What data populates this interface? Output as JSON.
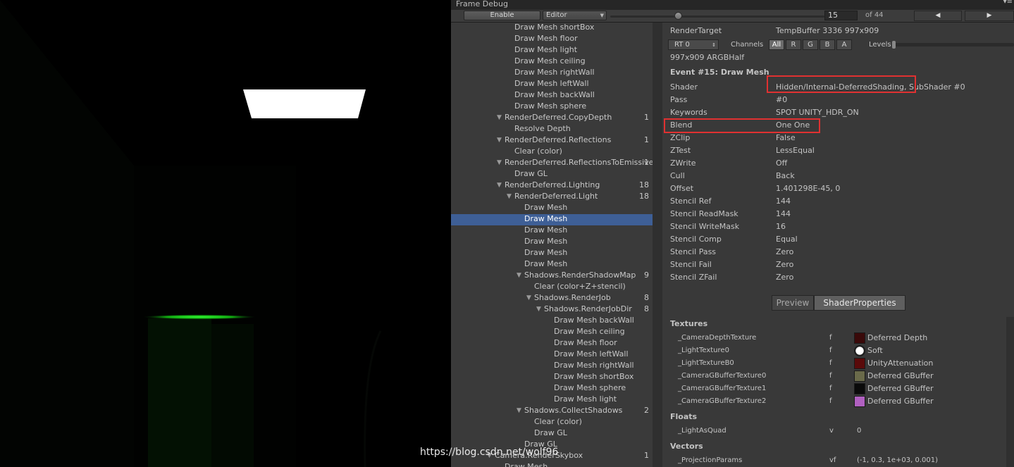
{
  "window": {
    "title": "Frame Debug",
    "menu_icon": "menu-icon"
  },
  "toolbar": {
    "enable_label": "Enable",
    "target_dropdown": "Editor",
    "event_index": "15",
    "event_of": "of 44",
    "prev_icon": "◀",
    "next_icon": "▶"
  },
  "tree": [
    {
      "label": "Draw Mesh shortBox",
      "indent": 5,
      "caret": false,
      "count": ""
    },
    {
      "label": "Draw Mesh floor",
      "indent": 5,
      "caret": false,
      "count": ""
    },
    {
      "label": "Draw Mesh light",
      "indent": 5,
      "caret": false,
      "count": ""
    },
    {
      "label": "Draw Mesh ceiling",
      "indent": 5,
      "caret": false,
      "count": ""
    },
    {
      "label": "Draw Mesh rightWall",
      "indent": 5,
      "caret": false,
      "count": ""
    },
    {
      "label": "Draw Mesh leftWall",
      "indent": 5,
      "caret": false,
      "count": ""
    },
    {
      "label": "Draw Mesh backWall",
      "indent": 5,
      "caret": false,
      "count": ""
    },
    {
      "label": "Draw Mesh sphere",
      "indent": 5,
      "caret": false,
      "count": ""
    },
    {
      "label": "RenderDeferred.CopyDepth",
      "indent": 4,
      "caret": true,
      "count": "1"
    },
    {
      "label": "Resolve Depth",
      "indent": 5,
      "caret": false,
      "count": ""
    },
    {
      "label": "RenderDeferred.Reflections",
      "indent": 4,
      "caret": true,
      "count": "1"
    },
    {
      "label": "Clear (color)",
      "indent": 5,
      "caret": false,
      "count": ""
    },
    {
      "label": "RenderDeferred.ReflectionsToEmissive",
      "indent": 4,
      "caret": true,
      "count": "1"
    },
    {
      "label": "Draw GL",
      "indent": 5,
      "caret": false,
      "count": ""
    },
    {
      "label": "RenderDeferred.Lighting",
      "indent": 4,
      "caret": true,
      "count": "18"
    },
    {
      "label": "RenderDeferred.Light",
      "indent": 5,
      "caret": true,
      "count": "18"
    },
    {
      "label": "Draw Mesh",
      "indent": 6,
      "caret": false,
      "count": ""
    },
    {
      "label": "Draw Mesh",
      "indent": 6,
      "caret": false,
      "count": "",
      "selected": true
    },
    {
      "label": "Draw Mesh",
      "indent": 6,
      "caret": false,
      "count": ""
    },
    {
      "label": "Draw Mesh",
      "indent": 6,
      "caret": false,
      "count": ""
    },
    {
      "label": "Draw Mesh",
      "indent": 6,
      "caret": false,
      "count": ""
    },
    {
      "label": "Draw Mesh",
      "indent": 6,
      "caret": false,
      "count": ""
    },
    {
      "label": "Shadows.RenderShadowMap",
      "indent": 6,
      "caret": true,
      "count": "9"
    },
    {
      "label": "Clear (color+Z+stencil)",
      "indent": 7,
      "caret": false,
      "count": ""
    },
    {
      "label": "Shadows.RenderJob",
      "indent": 7,
      "caret": true,
      "count": "8"
    },
    {
      "label": "Shadows.RenderJobDir",
      "indent": 8,
      "caret": true,
      "count": "8"
    },
    {
      "label": "Draw Mesh backWall",
      "indent": 9,
      "caret": false,
      "count": ""
    },
    {
      "label": "Draw Mesh ceiling",
      "indent": 9,
      "caret": false,
      "count": ""
    },
    {
      "label": "Draw Mesh floor",
      "indent": 9,
      "caret": false,
      "count": ""
    },
    {
      "label": "Draw Mesh leftWall",
      "indent": 9,
      "caret": false,
      "count": ""
    },
    {
      "label": "Draw Mesh rightWall",
      "indent": 9,
      "caret": false,
      "count": ""
    },
    {
      "label": "Draw Mesh shortBox",
      "indent": 9,
      "caret": false,
      "count": ""
    },
    {
      "label": "Draw Mesh sphere",
      "indent": 9,
      "caret": false,
      "count": ""
    },
    {
      "label": "Draw Mesh light",
      "indent": 9,
      "caret": false,
      "count": ""
    },
    {
      "label": "Shadows.CollectShadows",
      "indent": 6,
      "caret": true,
      "count": "2"
    },
    {
      "label": "Clear (color)",
      "indent": 7,
      "caret": false,
      "count": ""
    },
    {
      "label": "Draw GL",
      "indent": 7,
      "caret": false,
      "count": ""
    },
    {
      "label": "Draw GL",
      "indent": 6,
      "caret": false,
      "count": ""
    },
    {
      "label": "Camera.RenderSkybox",
      "indent": 3,
      "caret": true,
      "count": "1"
    },
    {
      "label": "Draw Mesh",
      "indent": 4,
      "caret": false,
      "count": ""
    }
  ],
  "detail": {
    "render_target_label": "RenderTarget",
    "render_target_value": "TempBuffer 3336 997x909",
    "rt_dropdown": "RT 0",
    "channels_label": "Channels",
    "channels": [
      "All",
      "R",
      "G",
      "B",
      "A"
    ],
    "levels_label": "Levels",
    "format": "997x909 ARGBHalf",
    "event_header": "Event #15: Draw Mesh",
    "state": [
      {
        "key": "Shader",
        "value": "Hidden/Internal-DeferredShading, SubShader #0"
      },
      {
        "key": "Pass",
        "value": "#0"
      },
      {
        "key": "Keywords",
        "value": "SPOT UNITY_HDR_ON"
      },
      {
        "key": "Blend",
        "value": "One One"
      },
      {
        "key": "ZClip",
        "value": "False"
      },
      {
        "key": "ZTest",
        "value": "LessEqual"
      },
      {
        "key": "ZWrite",
        "value": "Off"
      },
      {
        "key": "Cull",
        "value": "Back"
      },
      {
        "key": "Offset",
        "value": "1.401298E-45, 0"
      },
      {
        "key": "Stencil Ref",
        "value": "144"
      },
      {
        "key": "Stencil ReadMask",
        "value": "144"
      },
      {
        "key": "Stencil WriteMask",
        "value": "16"
      },
      {
        "key": "Stencil Comp",
        "value": "Equal"
      },
      {
        "key": "Stencil Pass",
        "value": "Zero"
      },
      {
        "key": "Stencil Fail",
        "value": "Zero"
      },
      {
        "key": "Stencil ZFail",
        "value": "Zero"
      }
    ],
    "tabs": [
      "Preview",
      "ShaderProperties"
    ],
    "textures_header": "Textures",
    "textures": [
      {
        "name": "_CameraDepthTexture",
        "flag": "f",
        "value": "Deferred Depth",
        "thumb_color": "#3a0a0a"
      },
      {
        "name": "_LightTexture0",
        "flag": "f",
        "value": "Soft",
        "thumb_color": "#ffffff"
      },
      {
        "name": "_LightTextureB0",
        "flag": "f",
        "value": "UnityAttenuation",
        "thumb_color": "#5a0a0a"
      },
      {
        "name": "_CameraGBufferTexture0",
        "flag": "f",
        "value": "Deferred GBuffer",
        "thumb_color": "#6a6a4a"
      },
      {
        "name": "_CameraGBufferTexture1",
        "flag": "f",
        "value": "Deferred GBuffer",
        "thumb_color": "#0a0a0a"
      },
      {
        "name": "_CameraGBufferTexture2",
        "flag": "f",
        "value": "Deferred GBuffer",
        "thumb_color": "#b060c0"
      }
    ],
    "floats_header": "Floats",
    "floats": [
      {
        "name": "_LightAsQuad",
        "flag": "v",
        "value": "0"
      }
    ],
    "vectors_header": "Vectors",
    "vectors": [
      {
        "name": "_ProjectionParams",
        "flag": "vf",
        "value": "(-1, 0.3, 1e+03, 0.001)"
      }
    ]
  },
  "colors": {
    "highlight_box": "#e03131",
    "selection": "#3e5f96",
    "scene_light_strip": "#22dd22"
  },
  "watermark": "https://blog.csdn.net/wolf96"
}
